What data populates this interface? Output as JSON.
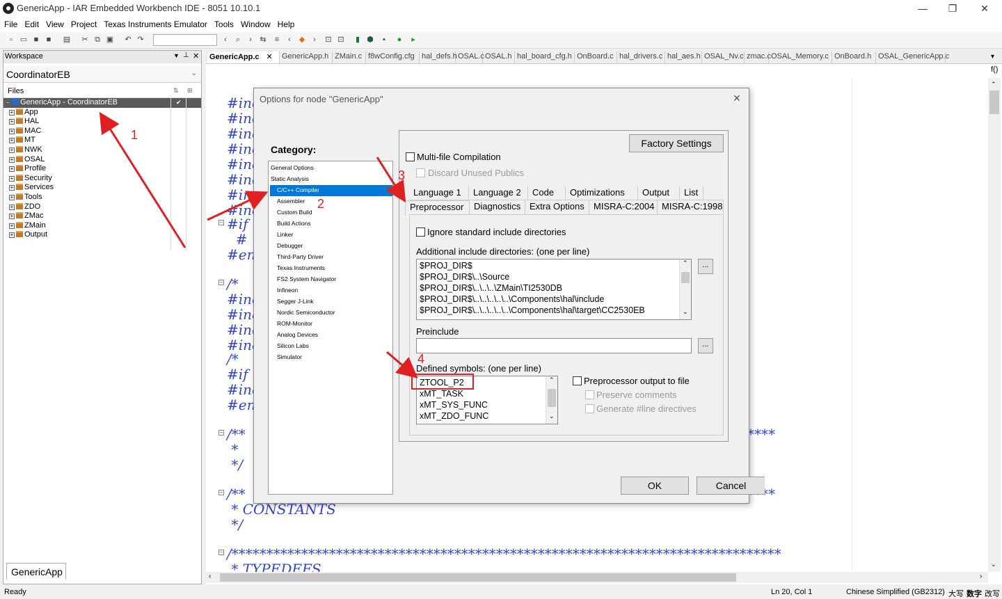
{
  "window": {
    "title": "GenericApp - IAR Embedded Workbench IDE - 8051 10.10.1",
    "min": "—",
    "max": "❐",
    "close": "✕"
  },
  "menu": [
    "File",
    "Edit",
    "View",
    "Project",
    "Texas Instruments Emulator",
    "Tools",
    "Window",
    "Help"
  ],
  "workspace": {
    "header": "Workspace",
    "config": "CoordinatorEB",
    "files_label": "Files",
    "project": "GenericApp - CoordinatorEB",
    "folders": [
      "App",
      "HAL",
      "MAC",
      "MT",
      "NWK",
      "OSAL",
      "Profile",
      "Security",
      "Services",
      "Tools",
      "ZDO",
      "ZMac",
      "ZMain",
      "Output"
    ],
    "tab": "GenericApp"
  },
  "editor": {
    "tabs": [
      "GenericApp.c",
      "GenericApp.h",
      "ZMain.c",
      "f8wConfig.cfg",
      "hal_defs.h",
      "OSAL.c",
      "OSAL.h",
      "hal_board_cfg.h",
      "OnBoard.c",
      "hal_drivers.c",
      "hal_aes.h",
      "OSAL_Nv.c",
      "zmac.c",
      "OSAL_Memory.c",
      "OnBoard.h",
      "OSAL_GenericApp.c"
    ],
    "code_lines": [
      "#inc",
      "#inc",
      "#inc",
      "#inc",
      "#inc",
      "#inc",
      "#inc",
      "#inc",
      "#if",
      "  #",
      "#end",
      "/* ",
      "#inc",
      "#inc",
      "#inc",
      "#inc",
      "/* ",
      "#if",
      "#inc",
      "#end",
      "/**",
      " * ",
      " */",
      "/**",
      " * CONSTANTS",
      " */",
      "/*******************************************************************************",
      " * TYPEDEFS"
    ],
    "star_tail": "****",
    "fold_label": "f()"
  },
  "status": {
    "left": "Ready",
    "pos": "Ln 20, Col 1",
    "ime": "Chinese Simplified (GB2312)",
    "caps": "大写",
    "num": "数字",
    "ovr": "改写"
  },
  "dialog": {
    "title": "Options for node \"GenericApp\"",
    "category_label": "Category:",
    "categories": [
      {
        "label": "General Options",
        "sub": false
      },
      {
        "label": "Static Analysis",
        "sub": false
      },
      {
        "label": "C/C++ Compiler",
        "sub": true,
        "selected": true
      },
      {
        "label": "Assembler",
        "sub": true
      },
      {
        "label": "Custom Build",
        "sub": true
      },
      {
        "label": "Build Actions",
        "sub": true
      },
      {
        "label": "Linker",
        "sub": true
      },
      {
        "label": "Debugger",
        "sub": true
      },
      {
        "label": "Third-Party Driver",
        "sub": true
      },
      {
        "label": "Texas Instruments",
        "sub": true
      },
      {
        "label": "FS2 System Navigator",
        "sub": true
      },
      {
        "label": "Infineon",
        "sub": true
      },
      {
        "label": "Segger J-Link",
        "sub": true
      },
      {
        "label": "Nordic Semiconductor",
        "sub": true
      },
      {
        "label": "ROM-Monitor",
        "sub": true
      },
      {
        "label": "Analog Devices",
        "sub": true
      },
      {
        "label": "Silicon Labs",
        "sub": true
      },
      {
        "label": "Simulator",
        "sub": true
      }
    ],
    "factory": "Factory Settings",
    "multi_file": "Multi-file Compilation",
    "discard": "Discard Unused Publics",
    "tabs_row1": [
      "Language 1",
      "Language 2",
      "Code",
      "Optimizations",
      "Output",
      "List"
    ],
    "tabs_row2": [
      "Preprocessor",
      "Diagnostics",
      "Extra Options",
      "MISRA-C:2004",
      "MISRA-C:1998"
    ],
    "ignore_std": "Ignore standard include directories",
    "include_label": "Additional include directories: (one per line)",
    "include_dirs": [
      "$PROJ_DIR$",
      "$PROJ_DIR$\\..\\Source",
      "$PROJ_DIR$\\..\\..\\..\\ZMain\\TI2530DB",
      "$PROJ_DIR$\\..\\..\\..\\..\\..\\Components\\hal\\include",
      "$PROJ_DIR$\\..\\..\\..\\..\\..\\Components\\hal\\target\\CC2530EB"
    ],
    "preinclude_label": "Preinclude",
    "preinclude_value": "",
    "defined_label": "Defined symbols: (one per line)",
    "defined": [
      "ZTOOL_P2",
      "xMT_TASK",
      "xMT_SYS_FUNC",
      "xMT_ZDO_FUNC"
    ],
    "pp_output": "Preprocessor output to file",
    "preserve": "Preserve comments",
    "gen_line": "Generate #line directives",
    "browse": "...",
    "ok": "OK",
    "cancel": "Cancel"
  },
  "annotations": [
    "1",
    "2",
    "3",
    "4"
  ],
  "colors": {
    "accent": "#0078d7",
    "annotation": "#e02020",
    "code": "#3344cc",
    "selected_tree": "#5a5a5a"
  }
}
